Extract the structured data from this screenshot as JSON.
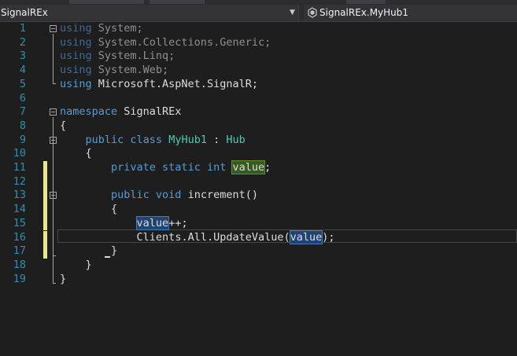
{
  "navbar": {
    "left_label": "SignalREx",
    "right_label": "SignalREx.MyHub1"
  },
  "editor": {
    "lines": [
      {
        "n": "1"
      },
      {
        "n": "2"
      },
      {
        "n": "3"
      },
      {
        "n": "4"
      },
      {
        "n": "5"
      },
      {
        "n": "6"
      },
      {
        "n": "7"
      },
      {
        "n": "8"
      },
      {
        "n": "9"
      },
      {
        "n": "10"
      },
      {
        "n": "11"
      },
      {
        "n": "12"
      },
      {
        "n": "13"
      },
      {
        "n": "14"
      },
      {
        "n": "15"
      },
      {
        "n": "16"
      },
      {
        "n": "17"
      },
      {
        "n": "18"
      },
      {
        "n": "19"
      }
    ],
    "code": {
      "l1_kw": "using",
      "l1_rest": " System;",
      "l2_kw": "using",
      "l2_rest": " System.Collections.Generic;",
      "l3_kw": "using",
      "l3_rest": " System.Linq;",
      "l4_kw": "using",
      "l4_rest": " System.Web;",
      "l5_kw": "using",
      "l5_rest": " Microsoft.AspNet.SignalR;",
      "l7_kw": "namespace",
      "l7_rest": " SignalREx",
      "l8": "{",
      "l9_kw": "public class",
      "l9_name": "MyHub1",
      "l9_colon": " : ",
      "l9_base": "Hub",
      "l10": "{",
      "l11_kw": "private static int",
      "l11_field": "value",
      "l11_end": ";",
      "l13_kw": "public void",
      "l13_rest": " increment()",
      "l14": "{",
      "l15_field": "value",
      "l15_rest": "++;",
      "l16_pre": "Clients.All.UpdateValue(",
      "l16_field": "value",
      "l16_end": ");",
      "l17": "}",
      "l18": "}",
      "l19": "}"
    }
  },
  "colors": {
    "background": "#1e1e1e",
    "keyword": "#569cd6",
    "type": "#4ec9b0",
    "line_number": "#2b91af",
    "change_marker": "#e8e88c"
  }
}
